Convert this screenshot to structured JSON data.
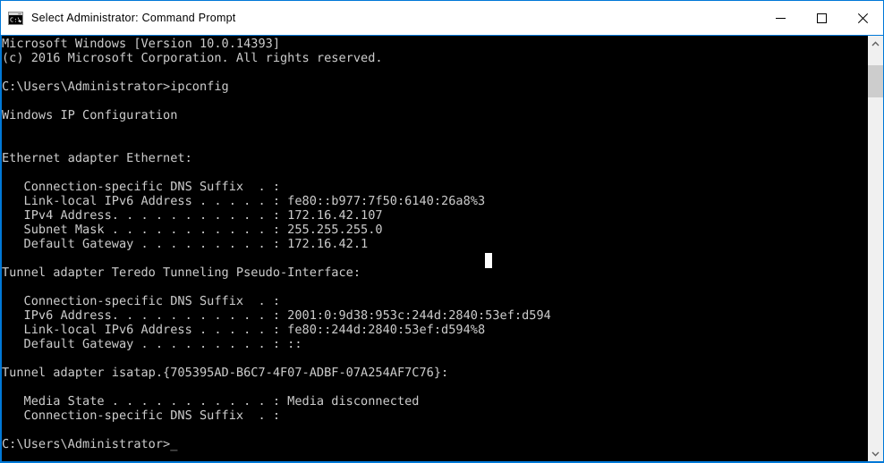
{
  "window": {
    "title": "Select Administrator: Command Prompt",
    "icon": "command-prompt-icon",
    "accent_color": "#0078d7",
    "titlebar_background": "#ffffff",
    "console_background": "#000000",
    "console_foreground": "#cccccc"
  },
  "caption": {
    "minimize_label": "Minimize",
    "maximize_label": "Maximize",
    "close_label": "Close"
  },
  "scrollbar": {
    "up_arrow_label": "Scroll up",
    "down_arrow_label": "Scroll down",
    "thumb_label": "Scroll thumb"
  },
  "console": {
    "cursor": "_",
    "lines": [
      "Microsoft Windows [Version 10.0.14393]",
      "(c) 2016 Microsoft Corporation. All rights reserved.",
      "",
      "C:\\Users\\Administrator>ipconfig",
      "",
      "Windows IP Configuration",
      "",
      "",
      "Ethernet adapter Ethernet:",
      "",
      "   Connection-specific DNS Suffix  . : ",
      "   Link-local IPv6 Address . . . . . : fe80::b977:7f50:6140:26a8%3",
      "   IPv4 Address. . . . . . . . . . . : 172.16.42.107",
      "   Subnet Mask . . . . . . . . . . . : 255.255.255.0",
      "   Default Gateway . . . . . . . . . : 172.16.42.1",
      "",
      "Tunnel adapter Teredo Tunneling Pseudo-Interface:",
      "",
      "   Connection-specific DNS Suffix  . : ",
      "   IPv6 Address. . . . . . . . . . . : 2001:0:9d38:953c:244d:2840:53ef:d594",
      "   Link-local IPv6 Address . . . . . : fe80::244d:2840:53ef:d594%8",
      "   Default Gateway . . . . . . . . . : ::",
      "",
      "Tunnel adapter isatap.{705395AD-B6C7-4F07-ADBF-07A254AF7C76}:",
      "",
      "   Media State . . . . . . . . . . . : Media disconnected",
      "   Connection-specific DNS Suffix  . : ",
      "",
      "C:\\Users\\Administrator>_"
    ]
  },
  "command_output": {
    "os_name": "Microsoft Windows",
    "os_version": "10.0.14393",
    "copyright": "(c) 2016 Microsoft Corporation. All rights reserved.",
    "prompt_path": "C:\\Users\\Administrator>",
    "command": "ipconfig",
    "section_title": "Windows IP Configuration",
    "adapters": [
      {
        "name": "Ethernet adapter Ethernet:",
        "fields": [
          {
            "label": "Connection-specific DNS Suffix",
            "value": ""
          },
          {
            "label": "Link-local IPv6 Address",
            "value": "fe80::b977:7f50:6140:26a8%3"
          },
          {
            "label": "IPv4 Address",
            "value": "172.16.42.107"
          },
          {
            "label": "Subnet Mask",
            "value": "255.255.255.0"
          },
          {
            "label": "Default Gateway",
            "value": "172.16.42.1"
          }
        ]
      },
      {
        "name": "Tunnel adapter Teredo Tunneling Pseudo-Interface:",
        "fields": [
          {
            "label": "Connection-specific DNS Suffix",
            "value": ""
          },
          {
            "label": "IPv6 Address",
            "value": "2001:0:9d38:953c:244d:2840:53ef:d594"
          },
          {
            "label": "Link-local IPv6 Address",
            "value": "fe80::244d:2840:53ef:d594%8"
          },
          {
            "label": "Default Gateway",
            "value": "::"
          }
        ]
      },
      {
        "name": "Tunnel adapter isatap.{705395AD-B6C7-4F07-ADBF-07A254AF7C76}:",
        "fields": [
          {
            "label": "Media State",
            "value": "Media disconnected"
          },
          {
            "label": "Connection-specific DNS Suffix",
            "value": ""
          }
        ]
      }
    ]
  }
}
